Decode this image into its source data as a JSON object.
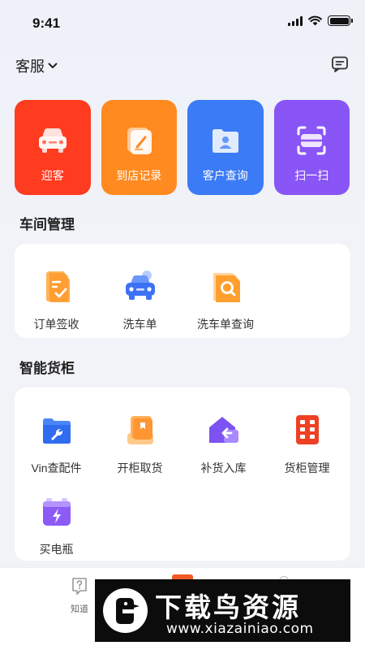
{
  "status_bar": {
    "time": "9:41"
  },
  "header": {
    "title": "客服",
    "chevron": "chevron-down-icon",
    "message_icon": "message-icon"
  },
  "quick_actions": [
    {
      "label": "迎客",
      "icon": "car-front-icon",
      "color": "#ff3b20"
    },
    {
      "label": "到店记录",
      "icon": "edit-record-icon",
      "color": "#ff8a1f"
    },
    {
      "label": "客户查询",
      "icon": "customer-folder-icon",
      "color": "#3c7bf6"
    },
    {
      "label": "扫一扫",
      "icon": "scan-icon",
      "color": "#8a55f7"
    }
  ],
  "sections": {
    "workshop": {
      "title": "车间管理",
      "items": [
        {
          "label": "订单签收",
          "icon": "order-sign-icon"
        },
        {
          "label": "洗车单",
          "icon": "car-wash-icon"
        },
        {
          "label": "洗车单查询",
          "icon": "wash-query-icon"
        }
      ]
    },
    "locker": {
      "title": "智能货柜",
      "items": [
        {
          "label": "Vin查配件",
          "icon": "vin-parts-icon"
        },
        {
          "label": "开柜取货",
          "icon": "open-locker-icon"
        },
        {
          "label": "补货入库",
          "icon": "restock-icon"
        },
        {
          "label": "货柜管理",
          "icon": "locker-manage-icon"
        },
        {
          "label": "买电瓶",
          "icon": "battery-buy-icon"
        }
      ]
    }
  },
  "tabbar": {
    "items": [
      {
        "label": "知道",
        "icon": "question-icon"
      }
    ]
  },
  "watermark": {
    "title": "下载鸟资源",
    "url": "www.xiazainiao.com"
  }
}
